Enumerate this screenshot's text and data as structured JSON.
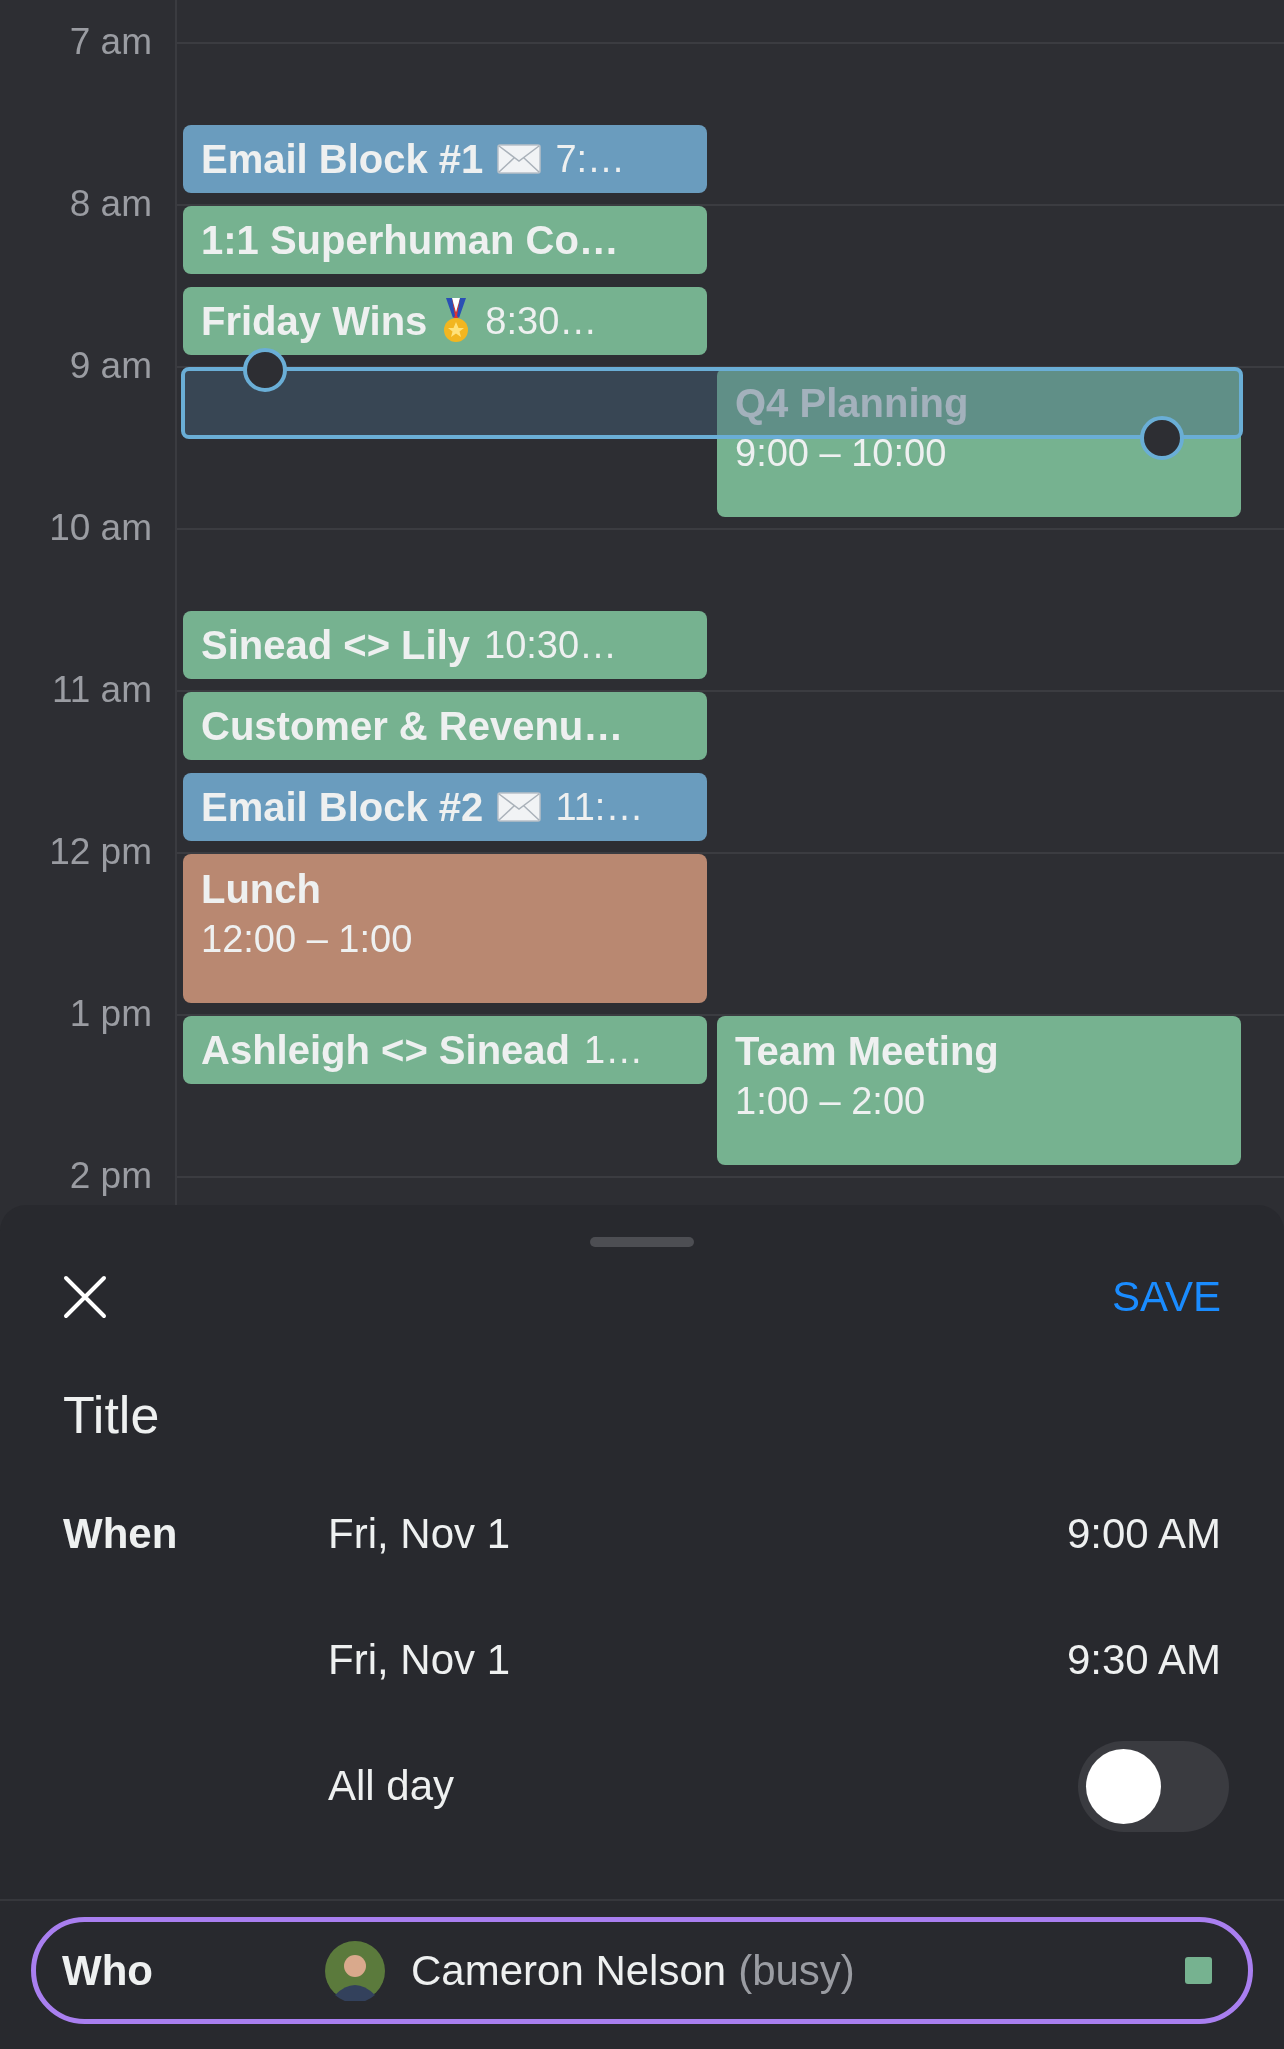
{
  "calendar": {
    "hours": [
      "7 am",
      "8 am",
      "9 am",
      "10 am",
      "11 am",
      "12 pm",
      "1 pm",
      "2 pm"
    ],
    "events": [
      {
        "kind": "compact",
        "title": "Email Block #1",
        "time": "7:…",
        "color": "#6a9cbe"
      },
      {
        "kind": "compact",
        "title": "1:1 Superhuman Co…",
        "color": "#76b290"
      },
      {
        "kind": "compact",
        "title": "Friday Wins",
        "time": "8:30…",
        "color": "#76b290"
      },
      {
        "kind": "block",
        "title": "Q4 Planning",
        "time": "9:00 – 10:00",
        "color": "#76b290"
      },
      {
        "kind": "compact",
        "title": "Sinead <> Lily",
        "time": "10:30…",
        "color": "#76b290"
      },
      {
        "kind": "compact",
        "title": "Customer & Revenu…",
        "color": "#76b290"
      },
      {
        "kind": "compact",
        "title": "Email Block #2",
        "time": "11:…",
        "color": "#6a9cbe"
      },
      {
        "kind": "block",
        "title": "Lunch",
        "time": "12:00 – 1:00",
        "color": "#b98871"
      },
      {
        "kind": "compact",
        "title": "Ashleigh <> Sinead",
        "time": "1…",
        "color": "#76b290"
      },
      {
        "kind": "block",
        "title": "Team Meeting",
        "time": "1:00 – 2:00",
        "color": "#76b290"
      }
    ]
  },
  "sheet": {
    "save": "SAVE",
    "title": {
      "placeholder": "Title"
    },
    "when": {
      "label": "When",
      "rows": [
        {
          "date": "Fri, Nov 1",
          "time": "9:00 AM"
        },
        {
          "date": "Fri, Nov 1",
          "time": "9:30 AM"
        }
      ],
      "all_day": {
        "label": "All day",
        "on": false
      }
    },
    "who": {
      "label": "Who",
      "name": "Cameron Nelson",
      "status": "(busy)",
      "color": "#76b290"
    }
  }
}
